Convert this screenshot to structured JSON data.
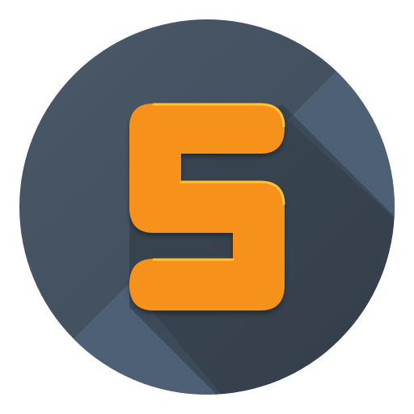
{
  "app_icon": {
    "icon": "letter-s-logo-icon",
    "colors": {
      "background": "#ffffff",
      "circle_base": "#3d4957",
      "circle_light": "#4a5868",
      "long_shadow": "#2f3944",
      "diagonal_band": "#4d6075",
      "glyph_fill": "#f6921e",
      "glyph_highlight": "#ffc23a",
      "glyph_shadow": "#c86f10"
    }
  }
}
